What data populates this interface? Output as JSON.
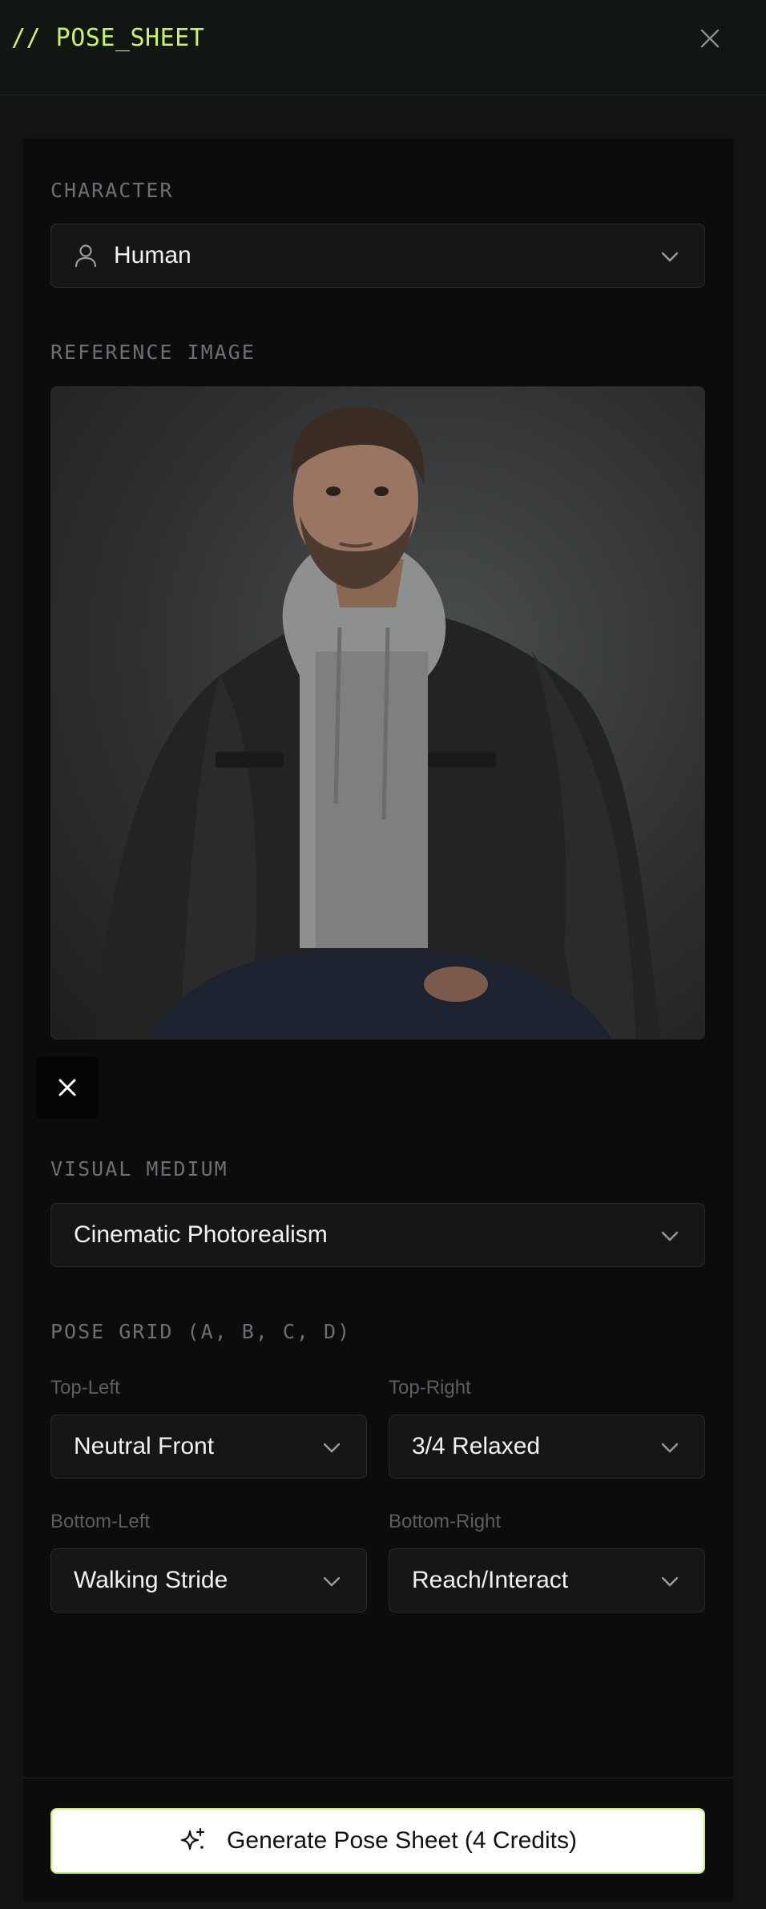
{
  "header": {
    "title": "// POSE_SHEET"
  },
  "character": {
    "label": "CHARACTER",
    "value": "Human"
  },
  "reference": {
    "label": "REFERENCE IMAGE",
    "alt": "Reference portrait"
  },
  "visual_medium": {
    "label": "VISUAL MEDIUM",
    "value": "Cinematic Photorealism"
  },
  "pose_grid": {
    "label": "POSE GRID (A, B, C, D)",
    "cells": [
      {
        "position": "Top-Left",
        "value": "Neutral Front"
      },
      {
        "position": "Top-Right",
        "value": "3/4 Relaxed"
      },
      {
        "position": "Bottom-Left",
        "value": "Walking Stride"
      },
      {
        "position": "Bottom-Right",
        "value": "Reach/Interact"
      }
    ]
  },
  "generate": {
    "label": "Generate Pose Sheet (4 Credits)"
  },
  "colors": {
    "accent": "#c8f26a",
    "background": "#111411",
    "panel": "#0c0c0d"
  }
}
